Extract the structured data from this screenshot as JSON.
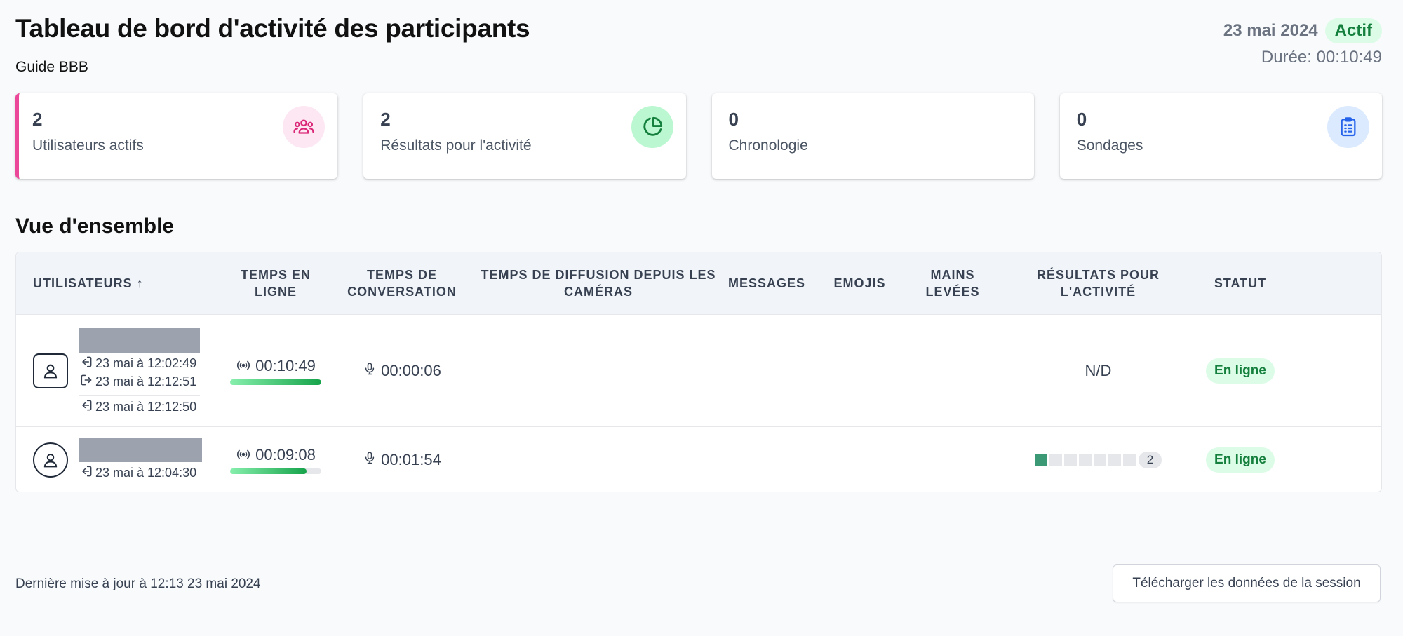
{
  "header": {
    "title": "Tableau de bord d'activité des participants",
    "subtitle": "Guide BBB",
    "date": "23 mai 2024",
    "status": "Actif",
    "duration": "Durée: 00:10:49"
  },
  "cards": [
    {
      "count": "2",
      "label": "Utilisateurs actifs",
      "icon": "users-icon"
    },
    {
      "count": "2",
      "label": "Résultats pour l'activité",
      "icon": "pie-chart-icon"
    },
    {
      "count": "0",
      "label": "Chronologie"
    },
    {
      "count": "0",
      "label": "Sondages",
      "icon": "clipboard-list-icon"
    }
  ],
  "overview": {
    "title": "Vue d'ensemble",
    "columns": {
      "users": "UTILISATEURS",
      "online_time": "TEMPS EN LIGNE",
      "talk_time": "TEMPS DE CONVERSATION",
      "webcam_time": "TEMPS DE DIFFUSION DEPUIS LES CAMÉRAS",
      "messages": "MESSAGES",
      "emojis": "EMOJIS",
      "raised_hands": "MAINS LEVÉES",
      "activity_results": "RÉSULTATS POUR L'ACTIVITÉ",
      "status": "STATUT"
    },
    "rows": [
      {
        "events": [
          "23 mai à 12:02:49",
          "23 mai à 12:12:51",
          "23 mai à 12:12:50"
        ],
        "online_time": "00:10:49",
        "online_fraction": 1.0,
        "talk_time": "00:00:06",
        "activity_result": "N/D",
        "status": "En ligne"
      },
      {
        "events": [
          "23 mai à 12:04:30"
        ],
        "online_time": "00:09:08",
        "online_fraction": 0.84,
        "talk_time": "00:01:54",
        "activity_filled": 1,
        "activity_total": 7,
        "activity_count": "2",
        "status": "En ligne"
      }
    ]
  },
  "footer": {
    "last_update": "Dernière mise à jour à 12:13 23 mai 2024",
    "download_label": "Télécharger les données de la session"
  },
  "colors": {
    "accent": "#ec4899",
    "online_green": "#15803d",
    "activity_square": "#3b9a75"
  }
}
